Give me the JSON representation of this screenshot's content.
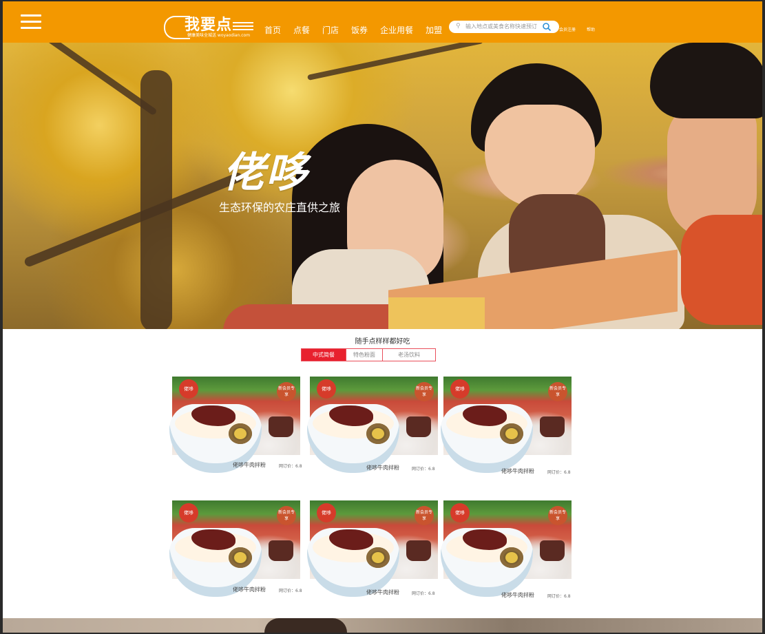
{
  "header": {
    "logo_text": "我要点",
    "logo_sub": "健康美味全城送 woyaodian.com",
    "nav": [
      "首页",
      "点餐",
      "门店",
      "饭券",
      "企业用餐",
      "加盟"
    ],
    "search_placeholder": "输入地点或美食名称快速预订",
    "links": [
      "会员注册",
      "帮助"
    ]
  },
  "banner": {
    "title": "佬哆",
    "subtitle": "生态环保的农庄直供之旅"
  },
  "section": {
    "title": "随手点样样都好吃",
    "tabs": [
      "中式简餐",
      "特色粉面",
      "老汤饮料"
    ],
    "active_tab": 0
  },
  "products": [
    {
      "name": "佬哆牛肉拌粉",
      "price": "网订价：6.8",
      "badge": "新会员专享",
      "brand": "佬哆"
    },
    {
      "name": "佬哆牛肉拌粉",
      "price": "网订价：6.8",
      "badge": "新会员专享",
      "brand": "佬哆"
    },
    {
      "name": "佬哆牛肉拌粉",
      "price": "网订价：6.8",
      "badge": "新会员专享",
      "brand": "佬哆"
    },
    {
      "name": "佬哆牛肉拌粉",
      "price": "网订价：6.8",
      "badge": "新会员专享",
      "brand": "佬哆"
    },
    {
      "name": "佬哆牛肉拌粉",
      "price": "网订价：6.8",
      "badge": "新会员专享",
      "brand": "佬哆"
    },
    {
      "name": "佬哆牛肉拌粉",
      "price": "网订价：6.8",
      "badge": "新会员专享",
      "brand": "佬哆"
    }
  ],
  "colors": {
    "header": "#f39800",
    "tab_active": "#e8212e",
    "tab_border": "#e94e5b"
  }
}
